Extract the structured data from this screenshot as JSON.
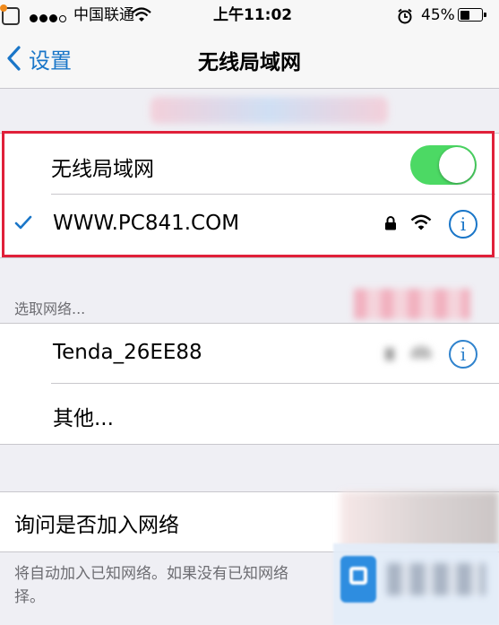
{
  "status_bar": {
    "carrier": "中国联通",
    "time": "上午11:02",
    "battery_percent": "45%",
    "battery_level": 0.45
  },
  "nav": {
    "back_label": "设置",
    "title": "无线局域网"
  },
  "wifi": {
    "label": "无线局域网",
    "enabled": true,
    "connected_network": "WWW.PC841.COM",
    "connected_locked": true
  },
  "choose_network": {
    "header": "选取网络...",
    "networks": [
      {
        "name": "Tenda_26EE88"
      }
    ],
    "other_label": "其他..."
  },
  "ask_to_join": {
    "label": "询问是否加入网络",
    "footer": "将自动加入已知网络。如果没有已知网络",
    "footer_line2": "择。"
  },
  "colors": {
    "accent": "#1a76c8",
    "switch_on": "#4cd964",
    "highlight": "#e0203a",
    "background": "#efeff4"
  }
}
